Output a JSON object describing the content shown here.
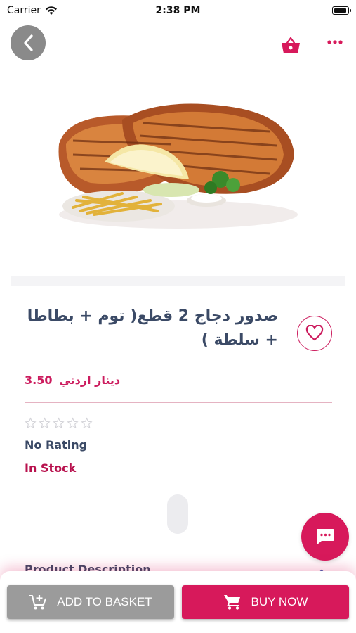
{
  "status_bar": {
    "carrier": "Carrier",
    "time": "2:38 PM"
  },
  "product": {
    "title": "صدور دجاج 2 قطع( توم + بطاطا + سلطة )",
    "price_currency": "دينار اردني",
    "price_value": "3.50",
    "rating_text": "No Rating",
    "rating_stars": 0,
    "rating_max": 5,
    "stock_text": "In Stock",
    "description_label": "Product Description"
  },
  "actions": {
    "add_to_basket": "ADD TO BASKET",
    "buy_now": "BUY NOW"
  },
  "icons": {
    "back": "chevron-left-icon",
    "basket": "basket-icon",
    "more": "more-dots-icon",
    "favorite": "heart-icon",
    "chat": "chat-icon",
    "add_cart": "add-cart-icon",
    "cart": "cart-icon"
  },
  "colors": {
    "accent": "#d7195b",
    "title": "#3b4a66",
    "button_grey": "#9b9b9b"
  }
}
